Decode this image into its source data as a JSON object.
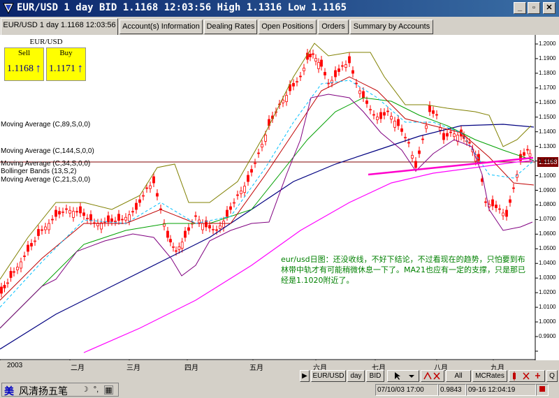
{
  "window": {
    "title": "EUR/USD 1 day BID 1.1168 12:03:56 High 1.1316 Low 1.1165",
    "minimize": "_",
    "maximize": "▫",
    "close": "✕"
  },
  "tabs": [
    {
      "label": "EUR/USD 1 day 1.1168 12:03:56",
      "active": true
    },
    {
      "label": "Account(s) Information"
    },
    {
      "label": "Dealing Rates"
    },
    {
      "label": "Open Positions"
    },
    {
      "label": "Orders"
    },
    {
      "label": "Summary by Accounts"
    }
  ],
  "quote": {
    "symbol": "EUR/USD",
    "sell_label": "Sell",
    "sell_value": "1.1168",
    "buy_label": "Buy",
    "buy_value": "1.1171",
    "arrow": "↑"
  },
  "indicators": [
    "Moving Average (C,89,S,0,0)",
    "Moving Average (C,144,S,0,0)",
    "Moving Average (C,34,S,0,0)",
    "Bollinger Bands (13,S,2)",
    "Moving Average (C,21,S,0,0)"
  ],
  "note": "eur/usd日图：还没收线，不好下结论，不过看现在的趋势，只怕要到布林带中轨才有可能稍微休息一下了。MA21也应有一定的支撑，只是那已经是1.1020附近了。",
  "price_axis": [
    "1.2000",
    "1.1900",
    "1.1800",
    "1.1700",
    "1.1600",
    "1.1500",
    "1.1400",
    "1.1300",
    "1.1168",
    "1.1100",
    "1.1000",
    "1.0900",
    "1.0800",
    "1.0700",
    "1.0600",
    "1.0500",
    "1.0400",
    "1.0300",
    "1.0200",
    "1.0100",
    "1.0000",
    "0.9900"
  ],
  "current_price": "1.1168",
  "time_axis": [
    "2003",
    "二月",
    "三月",
    "四月",
    "五月",
    "六月",
    "七月",
    "八月",
    "九月"
  ],
  "scroll_buttons": {
    "left": "◀",
    "right": "▶",
    "symbol": "EUR/USD",
    "period": "day",
    "side": "BID",
    "all": "All",
    "mcrates": "MCRates",
    "q": "Q"
  },
  "status": {
    "ime_mark": "美",
    "ime_name": "风清扬五笔",
    "date_time": "07/10/03 17:00",
    "value": "0.9843",
    "timestamp": "09-16 12:04:19"
  },
  "colors": {
    "candle": "#ff0000",
    "bollinger": "#808000",
    "bollinger_lower": "#800080",
    "ma21": "#c00000",
    "ma34": "#00a000",
    "ma89": "#000080",
    "ma144": "#ff00ff",
    "mid_band": "#00c0ff",
    "note": "#008000",
    "price_tag": "#800000"
  }
}
